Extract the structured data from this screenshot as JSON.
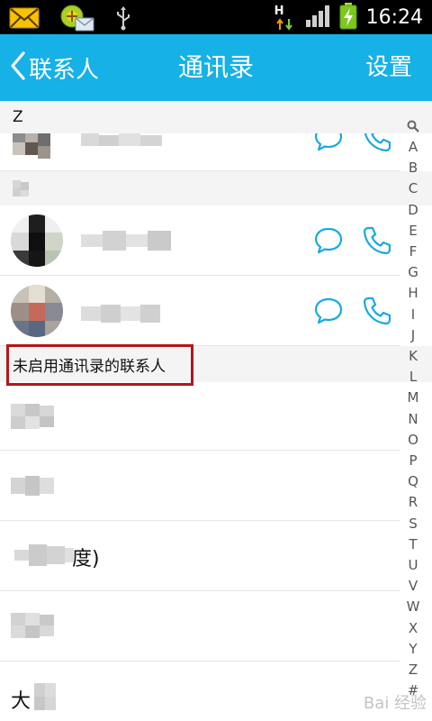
{
  "status_bar": {
    "time": "16:24",
    "network_label": "H",
    "icons": [
      "mail-icon",
      "contacts-sync-icon",
      "usb-icon",
      "data-arrows-icon",
      "signal-icon",
      "battery-charging-icon"
    ]
  },
  "header": {
    "back_label": "联系人",
    "title": "通讯录",
    "settings_label": "设置"
  },
  "sections": {
    "z": "Z",
    "z_sub": "Z",
    "not_enabled": "未启用通讯录的联系人"
  },
  "rows": {
    "partial_name": "度)",
    "last_name_prefix": "大"
  },
  "index_letters": [
    "A",
    "B",
    "C",
    "D",
    "E",
    "F",
    "G",
    "H",
    "I",
    "J",
    "K",
    "L",
    "M",
    "N",
    "O",
    "P",
    "Q",
    "R",
    "S",
    "T",
    "U",
    "V",
    "W",
    "X",
    "Y",
    "Z",
    "#"
  ],
  "colors": {
    "header": "#16b1e6",
    "accent_icon": "#1aa9e0",
    "highlight": "#b3151b"
  },
  "watermark": "Bai 经验"
}
